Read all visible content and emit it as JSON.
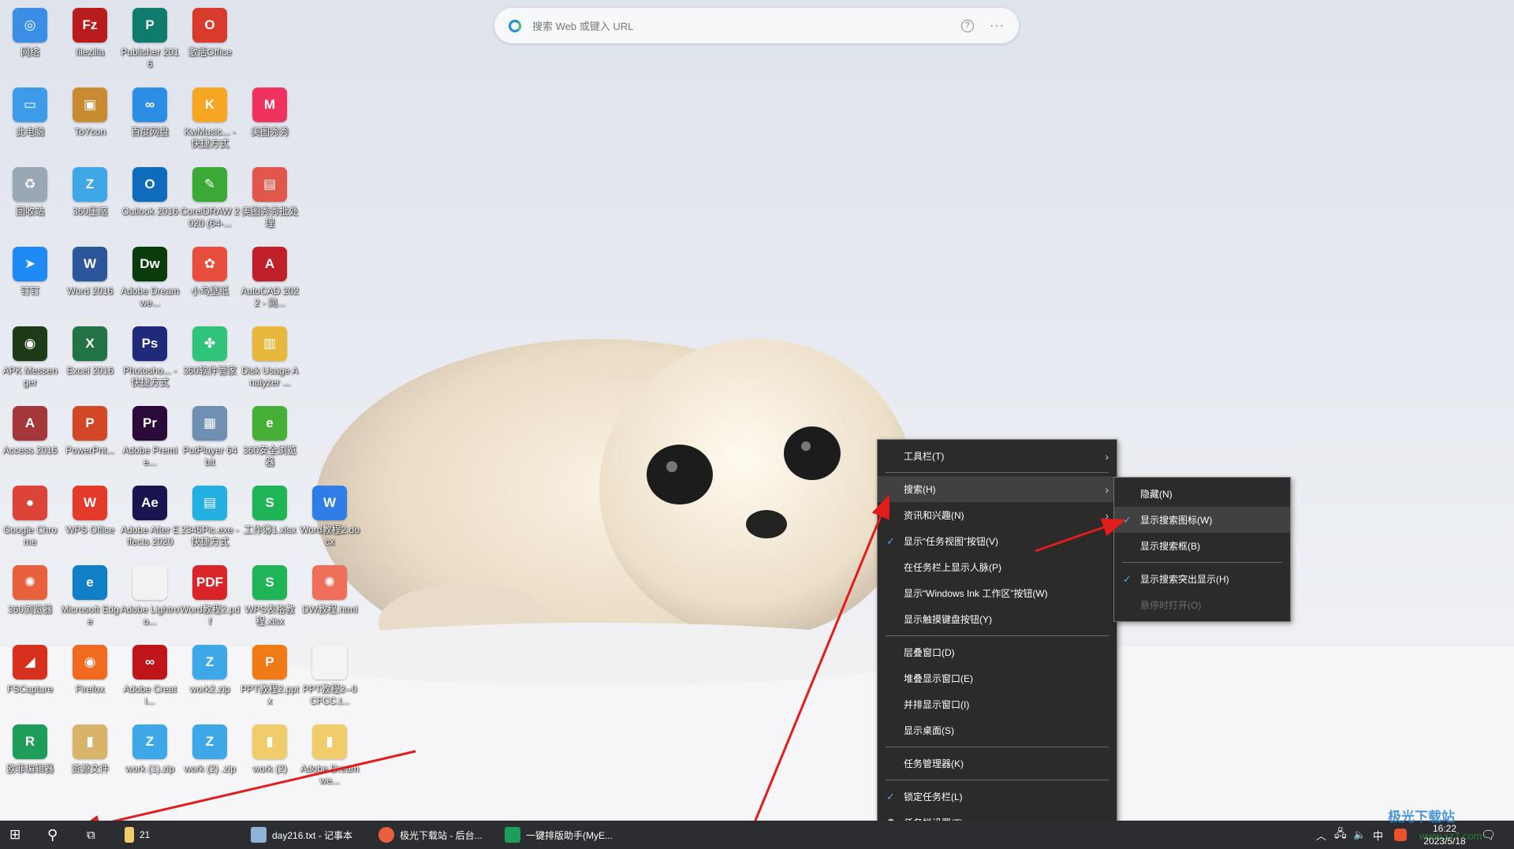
{
  "browser_search": {
    "placeholder": "搜索 Web 或键入 URL",
    "help_icon": "question-icon",
    "more_icon": "ellipsis-icon"
  },
  "desktop": {
    "rows": [
      [
        {
          "label": "网络",
          "g": "◎",
          "c": "#3a8ee6"
        },
        {
          "label": "filezilla",
          "g": "Fz",
          "c": "#b81c1c"
        },
        {
          "label": "Publisher 2016",
          "g": "P",
          "c": "#0f7b6c"
        },
        {
          "label": "激活Office",
          "g": "O",
          "c": "#d83b2b"
        }
      ],
      [
        {
          "label": "此电脑",
          "g": "▭",
          "c": "#3d9be9"
        },
        {
          "label": "ToYcon",
          "g": "▣",
          "c": "#c98b2f"
        },
        {
          "label": "百度网盘",
          "g": "∞",
          "c": "#2b8de3"
        },
        {
          "label": "KwMusic... - 快捷方式",
          "g": "K",
          "c": "#f6a623"
        },
        {
          "label": "美图秀秀",
          "g": "M",
          "c": "#f0325f"
        }
      ],
      [
        {
          "label": "回收站",
          "g": "♻",
          "c": "#9aa7b5"
        },
        {
          "label": "360压缩",
          "g": "Z",
          "c": "#3ea7e8"
        },
        {
          "label": "Outlook 2016",
          "g": "O",
          "c": "#0f6cbd"
        },
        {
          "label": "CorelDRAW 2020 (64-...",
          "g": "✎",
          "c": "#3aa935"
        },
        {
          "label": "美图秀秀批处理",
          "g": "▤",
          "c": "#e2574c"
        }
      ],
      [
        {
          "label": "钉钉",
          "g": "➤",
          "c": "#1e8af5"
        },
        {
          "label": "Word 2016",
          "g": "W",
          "c": "#2b579a"
        },
        {
          "label": "Adobe Dreamwe...",
          "g": "Dw",
          "c": "#0a3b0a"
        },
        {
          "label": "小鸟壁纸",
          "g": "✿",
          "c": "#e84d3d"
        },
        {
          "label": "AutoCAD 2022 - 简...",
          "g": "A",
          "c": "#c0202a"
        }
      ],
      [
        {
          "label": "APK Messenger",
          "g": "◉",
          "c": "#1d3b17"
        },
        {
          "label": "Excel 2016",
          "g": "X",
          "c": "#217346"
        },
        {
          "label": "Photosho... - 快捷方式",
          "g": "Ps",
          "c": "#1f2a7a"
        },
        {
          "label": "360软件管家",
          "g": "✤",
          "c": "#30c47a"
        },
        {
          "label": "Disk Usage Analyzer ...",
          "g": "▥",
          "c": "#e7b83c"
        }
      ],
      [
        {
          "label": "Access 2016",
          "g": "A",
          "c": "#a4373a"
        },
        {
          "label": "PowerPnt...",
          "g": "P",
          "c": "#d24726"
        },
        {
          "label": "Adobe Premie...",
          "g": "Pr",
          "c": "#2a0a3a"
        },
        {
          "label": "PotPlayer 64 bit",
          "g": "▦",
          "c": "#6f8fb3"
        },
        {
          "label": "360安全浏览器",
          "g": "e",
          "c": "#45b035"
        }
      ],
      [
        {
          "label": "Google Chrome",
          "g": "●",
          "c": "#db4437"
        },
        {
          "label": "WPS Office",
          "g": "W",
          "c": "#e33a2c"
        },
        {
          "label": "Adobe After Effects 2020",
          "g": "Ae",
          "c": "#1a1550"
        },
        {
          "label": "2345Pic.exe - 快捷方式",
          "g": "▤",
          "c": "#23b0e0"
        },
        {
          "label": "工作簿1.xlsx",
          "g": "S",
          "c": "#1fb455"
        },
        {
          "label": "Word教程2.docx",
          "g": "W",
          "c": "#2f7ee8"
        }
      ],
      [
        {
          "label": "360浏览器",
          "g": "✺",
          "c": "#e8603c"
        },
        {
          "label": "Microsoft Edge",
          "g": "e",
          "c": "#0f7fc6"
        },
        {
          "label": "Adobe Lightroo...",
          "g": "",
          "c": "#f2f2f2"
        },
        {
          "label": "Word教程2.pdf",
          "g": "PDF",
          "c": "#d9252a"
        },
        {
          "label": "WPS表格教程.xlsx",
          "g": "S",
          "c": "#1fb455"
        },
        {
          "label": "DW教程.html",
          "g": "✺",
          "c": "#ef6f5a"
        }
      ],
      [
        {
          "label": "FSCapture",
          "g": "◢",
          "c": "#d7301f"
        },
        {
          "label": "Firefox",
          "g": "◉",
          "c": "#f06a1f"
        },
        {
          "label": "Adobe Creati...",
          "g": "∞",
          "c": "#c0141b"
        },
        {
          "label": "work2.zip",
          "g": "Z",
          "c": "#3ea7e8"
        },
        {
          "label": "PPT教程2.pptx",
          "g": "P",
          "c": "#f07a16"
        },
        {
          "label": "PPT教程2--0CFCC.t...",
          "g": "",
          "c": "#f4f4f4"
        }
      ],
      [
        {
          "label": "欧菲编辑器",
          "g": "R",
          "c": "#1e9c5a"
        },
        {
          "label": "资源文件",
          "g": "▮",
          "c": "#d8b46a"
        },
        {
          "label": "work (1).zip",
          "g": "Z",
          "c": "#3ea7e8"
        },
        {
          "label": "work (2) .zip",
          "g": "Z",
          "c": "#3ea7e8"
        },
        {
          "label": "work (2)",
          "g": "▮",
          "c": "#f0cd6a"
        },
        {
          "label": "Adobe Dreamwe...",
          "g": "▮",
          "c": "#f0cd6a"
        }
      ]
    ]
  },
  "context_menu": {
    "items": [
      {
        "label": "工具栏(T)",
        "submenu": true
      },
      {
        "sep": true
      },
      {
        "label": "搜索(H)",
        "submenu": true,
        "highlighted": true
      },
      {
        "label": "资讯和兴趣(N)",
        "submenu": true
      },
      {
        "label": "显示“任务视图”按钮(V)",
        "checked": true
      },
      {
        "label": "在任务栏上显示人脉(P)"
      },
      {
        "label": "显示“Windows Ink 工作区”按钮(W)"
      },
      {
        "label": "显示触摸键盘按钮(Y)"
      },
      {
        "sep": true
      },
      {
        "label": "层叠窗口(D)"
      },
      {
        "label": "堆叠显示窗口(E)"
      },
      {
        "label": "并排显示窗口(I)"
      },
      {
        "label": "显示桌面(S)"
      },
      {
        "sep": true
      },
      {
        "label": "任务管理器(K)"
      },
      {
        "sep": true
      },
      {
        "label": "锁定任务栏(L)",
        "checked": true
      },
      {
        "label": "任务栏设置(T)",
        "icon": "gear-icon"
      }
    ]
  },
  "search_submenu": {
    "items": [
      {
        "label": "隐藏(N)"
      },
      {
        "label": "显示搜索图标(W)",
        "checked": true,
        "highlighted": true
      },
      {
        "label": "显示搜索框(B)"
      },
      {
        "sep": true
      },
      {
        "label": "显示搜索突出显示(H)",
        "checked": true
      },
      {
        "label": "悬停时打开(O)",
        "disabled": true
      }
    ]
  },
  "taskbar": {
    "explorer_label": "21",
    "apps": [
      {
        "label": "day216.txt - 记事本",
        "color": "#8fb3d6"
      },
      {
        "label": "极光下载站 - 后台...",
        "color": "#e8603c"
      },
      {
        "label": "一键排版助手(MyE...",
        "color": "#1e9c5a"
      }
    ],
    "tray": {
      "ime": "中",
      "time": "16:22",
      "date": "2023/5/18"
    }
  },
  "watermark": {
    "name": "极光下载站",
    "url": "www.xz7.com"
  },
  "colors": {
    "annotation_arrow": "#e21b1b",
    "menu_bg": "#2b2b2b",
    "check": "#5aa0e6"
  }
}
